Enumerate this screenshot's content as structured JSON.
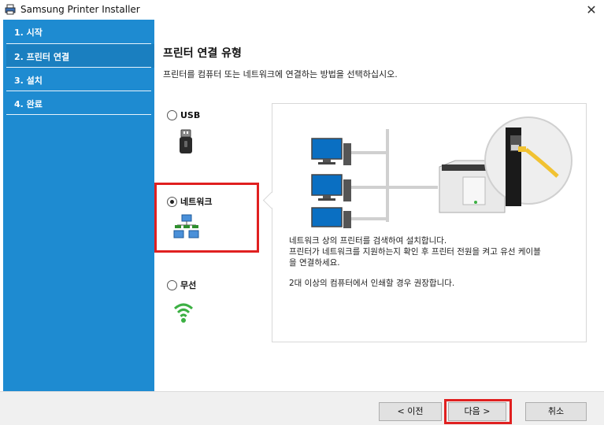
{
  "window": {
    "title": "Samsung Printer Installer",
    "close_icon": "close-icon"
  },
  "sidebar": {
    "items": [
      {
        "label": "1. 시작"
      },
      {
        "label": "2. 프린터 연결"
      },
      {
        "label": "3. 설치"
      },
      {
        "label": "4. 완료"
      }
    ]
  },
  "main": {
    "heading": "프린터 연결 유형",
    "subtitle": "프린터를 컴퓨터 또는 네트워크에 연결하는 방법을 선택하십시오.",
    "options": [
      {
        "label": "USB",
        "selected": false,
        "icon": "usb-icon"
      },
      {
        "label": "네트워크",
        "selected": true,
        "icon": "network-icon"
      },
      {
        "label": "무선",
        "selected": false,
        "icon": "wifi-icon"
      }
    ],
    "description": {
      "line1": "네트워크 상의 프린터를 검색하여 설치합니다.",
      "line2": "프린터가 네트워크를 지원하는지 확인 후 프린터 전원을 켜고 유선 케이블",
      "line3": "을 연결하세요.",
      "line4": "2대 이상의 컴퓨터에서 인쇄할 경우 권장합니다."
    }
  },
  "footer": {
    "prev_label": "< 이전",
    "next_label": "다음 >",
    "cancel_label": "취소"
  },
  "colors": {
    "sidebar": "#1e8bd1",
    "highlight": "#e02020"
  }
}
